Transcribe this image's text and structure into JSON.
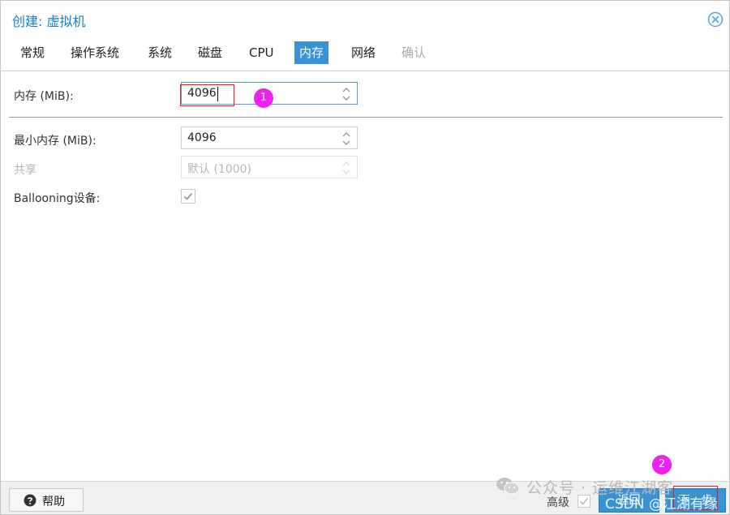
{
  "window": {
    "title": "创建: 虚拟机"
  },
  "tabs": [
    {
      "label": "常规",
      "state": "normal"
    },
    {
      "label": "操作系统",
      "state": "normal"
    },
    {
      "label": "系统",
      "state": "normal"
    },
    {
      "label": "磁盘",
      "state": "normal"
    },
    {
      "label": "CPU",
      "state": "normal"
    },
    {
      "label": "内存",
      "state": "active"
    },
    {
      "label": "网络",
      "state": "normal"
    },
    {
      "label": "确认",
      "state": "disabled"
    }
  ],
  "form": {
    "memory": {
      "label": "内存 (MiB):",
      "value": "4096"
    },
    "min_memory": {
      "label": "最小内存 (MiB):",
      "value": "4096"
    },
    "shares": {
      "label": "共享",
      "placeholder": "默认 (1000)"
    },
    "ballooning": {
      "label": "Ballooning设备:",
      "checked": true
    }
  },
  "annotations": {
    "marker1": "1",
    "marker2": "2"
  },
  "footer": {
    "help_label": "帮助",
    "advanced_label": "高级",
    "advanced_checked": false,
    "back_label": "返回",
    "next_label": "下一步"
  },
  "watermark": {
    "text": "公众号 · 运维江湖客",
    "text2": "CSDN @江湖有缘"
  },
  "colors": {
    "accent": "#3892d4",
    "title": "#157fcc",
    "marker": "#ee22ee",
    "highlight_box": "#e02020"
  }
}
